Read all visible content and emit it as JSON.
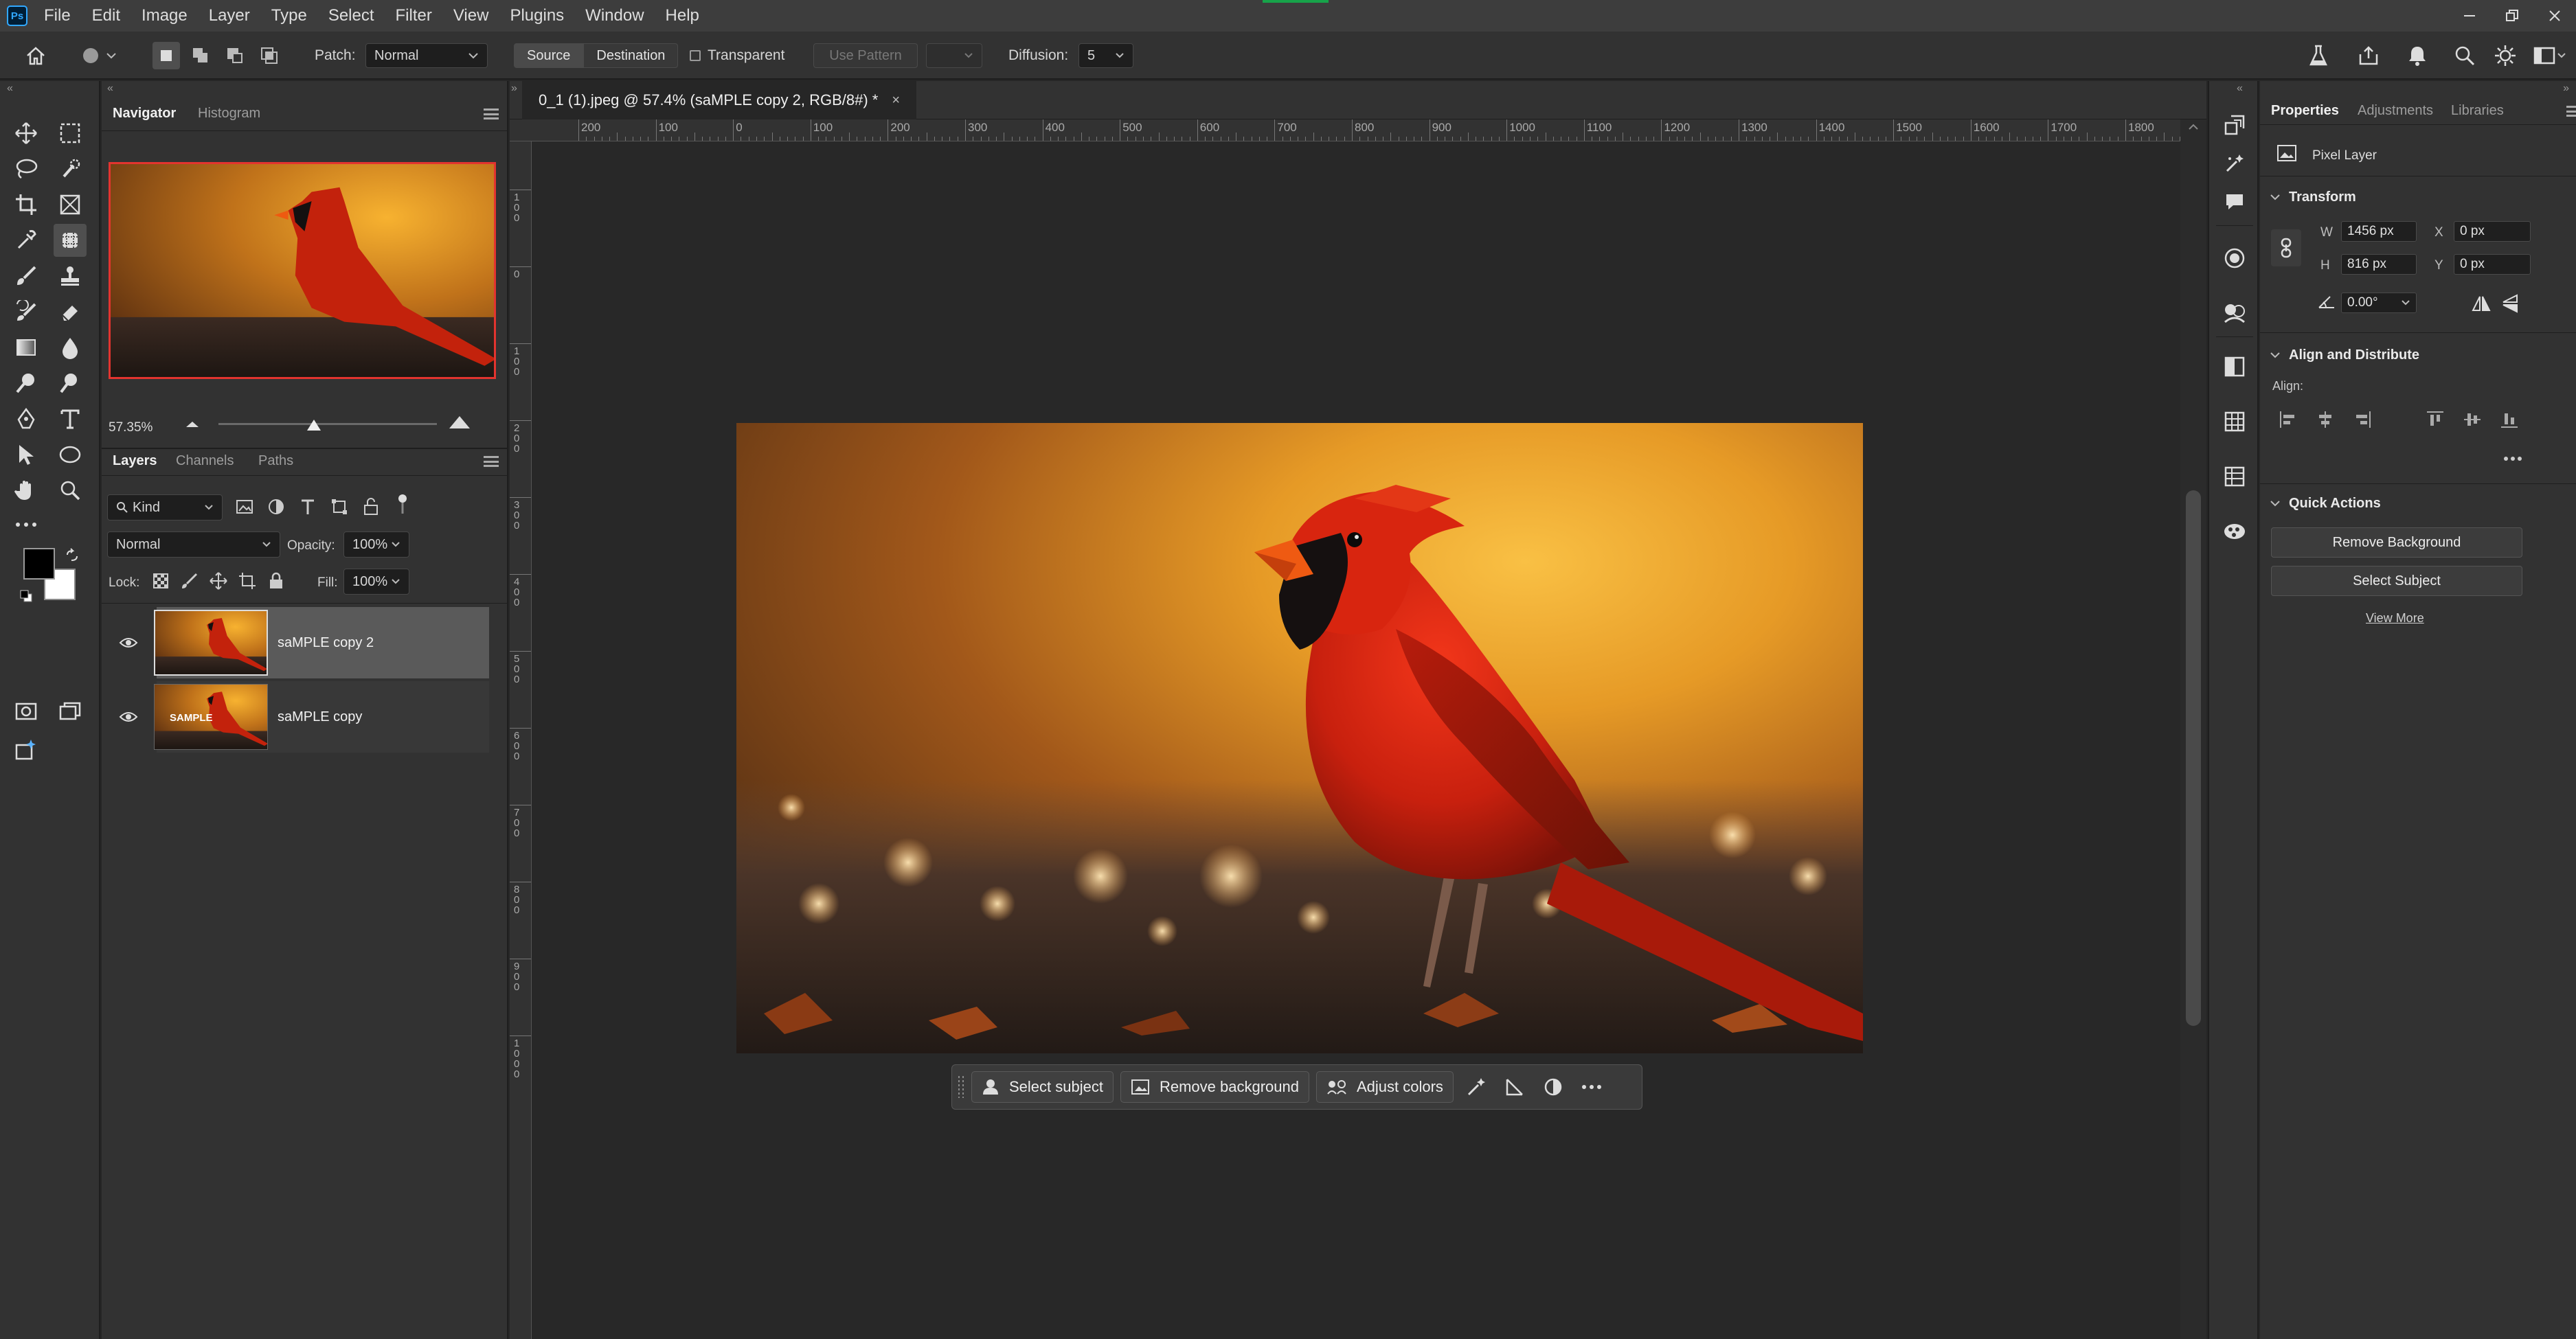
{
  "app": {
    "logo": "Ps"
  },
  "menu": [
    "File",
    "Edit",
    "Image",
    "Layer",
    "Type",
    "Select",
    "Filter",
    "View",
    "Plugins",
    "Window",
    "Help"
  ],
  "options": {
    "patch_label": "Patch:",
    "patch_mode": "Normal",
    "source": "Source",
    "destination": "Destination",
    "transparent": "Transparent",
    "use_pattern": "Use Pattern",
    "diffusion_label": "Diffusion:",
    "diffusion_value": "5"
  },
  "document": {
    "tab_title": "0_1 (1).jpeg @ 57.4% (saMPLE copy 2, RGB/8#) *",
    "ruler_top": [
      "200",
      "100",
      "0",
      "100",
      "200",
      "300",
      "400",
      "500",
      "600",
      "700",
      "800",
      "900",
      "1000",
      "1100",
      "1200",
      "1300",
      "1400",
      "1500",
      "1600",
      "1700",
      "1800"
    ],
    "ruler_left": [
      "1 0 0",
      "0",
      "1 0 0",
      "2 0 0",
      "3 0 0",
      "4 0 0",
      "5 0 0",
      "6 0 0",
      "7 0 0",
      "8 0 0",
      "9 0 0",
      "1 0 0 0"
    ]
  },
  "navigator": {
    "tabs": [
      "Navigator",
      "Histogram"
    ],
    "zoom": "57.35%"
  },
  "layers_panel": {
    "tabs": [
      "Layers",
      "Channels",
      "Paths"
    ],
    "filter_kind": "Kind",
    "blend_mode": "Normal",
    "opacity_label": "Opacity:",
    "opacity": "100%",
    "lock_label": "Lock:",
    "fill_label": "Fill:",
    "fill": "100%",
    "layers": [
      {
        "name": "saMPLE copy 2",
        "selected": true
      },
      {
        "name": "saMPLE copy",
        "selected": false,
        "thumb_text": "SAMPLE"
      }
    ]
  },
  "context_bar": {
    "select_subject": "Select subject",
    "remove_background": "Remove background",
    "adjust_colors": "Adjust colors"
  },
  "properties": {
    "tabs": [
      "Properties",
      "Adjustments",
      "Libraries"
    ],
    "layer_type": "Pixel Layer",
    "transform": {
      "title": "Transform",
      "w_label": "W",
      "w": "1456 px",
      "h_label": "H",
      "h": "816 px",
      "x_label": "X",
      "x": "0 px",
      "y_label": "Y",
      "y": "0 px",
      "angle": "0.00°"
    },
    "align": {
      "title": "Align and Distribute",
      "align_label": "Align:"
    },
    "quick_actions": {
      "title": "Quick Actions",
      "remove_background": "Remove Background",
      "select_subject": "Select Subject",
      "view_more": "View More"
    }
  },
  "colors": {
    "foreground": "#000000",
    "background": "#ffffff",
    "accent": "#31a8ff"
  }
}
